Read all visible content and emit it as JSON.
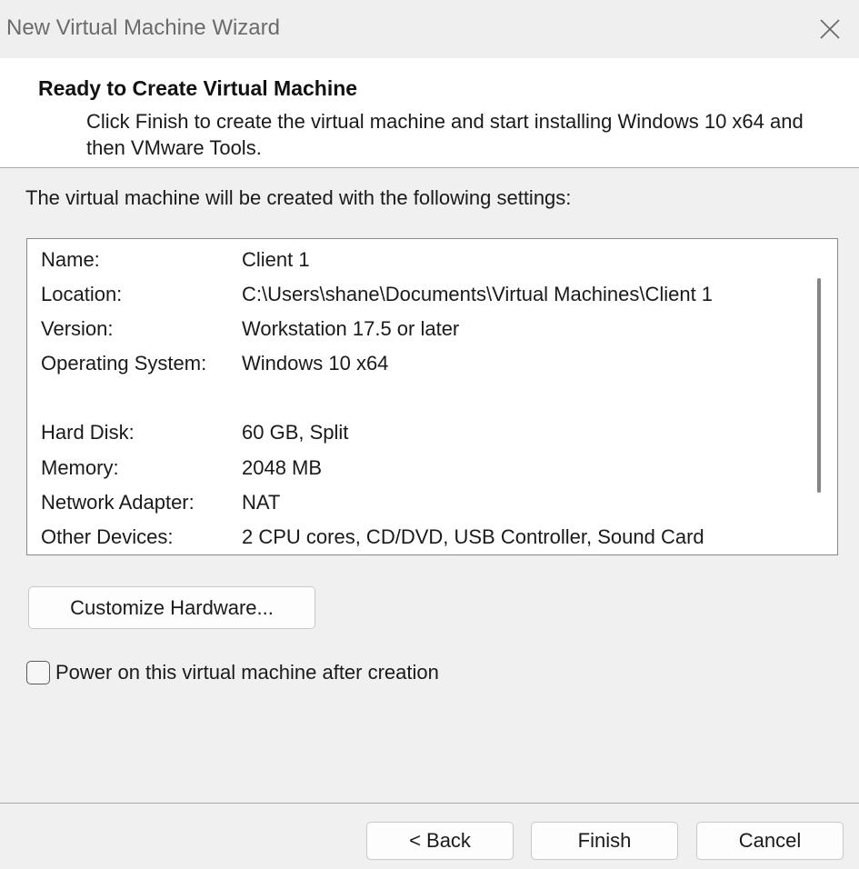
{
  "window": {
    "title": "New Virtual Machine Wizard",
    "close_icon": "close-icon"
  },
  "header": {
    "title": "Ready to Create Virtual Machine",
    "description": "Click Finish to create the virtual machine and start installing Windows 10 x64 and then VMware Tools."
  },
  "intro": "The virtual machine will be created with the following settings:",
  "settings": [
    {
      "label": "Name:",
      "value": "Client 1"
    },
    {
      "label": "Location:",
      "value": "C:\\Users\\shane\\Documents\\Virtual Machines\\Client 1"
    },
    {
      "label": "Version:",
      "value": "Workstation 17.5 or later"
    },
    {
      "label": "Operating System:",
      "value": "Windows 10 x64"
    },
    {
      "label": "Hard Disk:",
      "value": "60 GB, Split"
    },
    {
      "label": "Memory:",
      "value": "2048 MB"
    },
    {
      "label": "Network Adapter:",
      "value": "NAT"
    },
    {
      "label": "Other Devices:",
      "value": "2 CPU cores, CD/DVD, USB Controller, Sound Card"
    }
  ],
  "customize_button": "Customize Hardware...",
  "power_on": {
    "label": "Power on this virtual machine after creation",
    "checked": false
  },
  "footer": {
    "back_label": "< Back",
    "finish_label": "Finish",
    "cancel_label": "Cancel"
  }
}
